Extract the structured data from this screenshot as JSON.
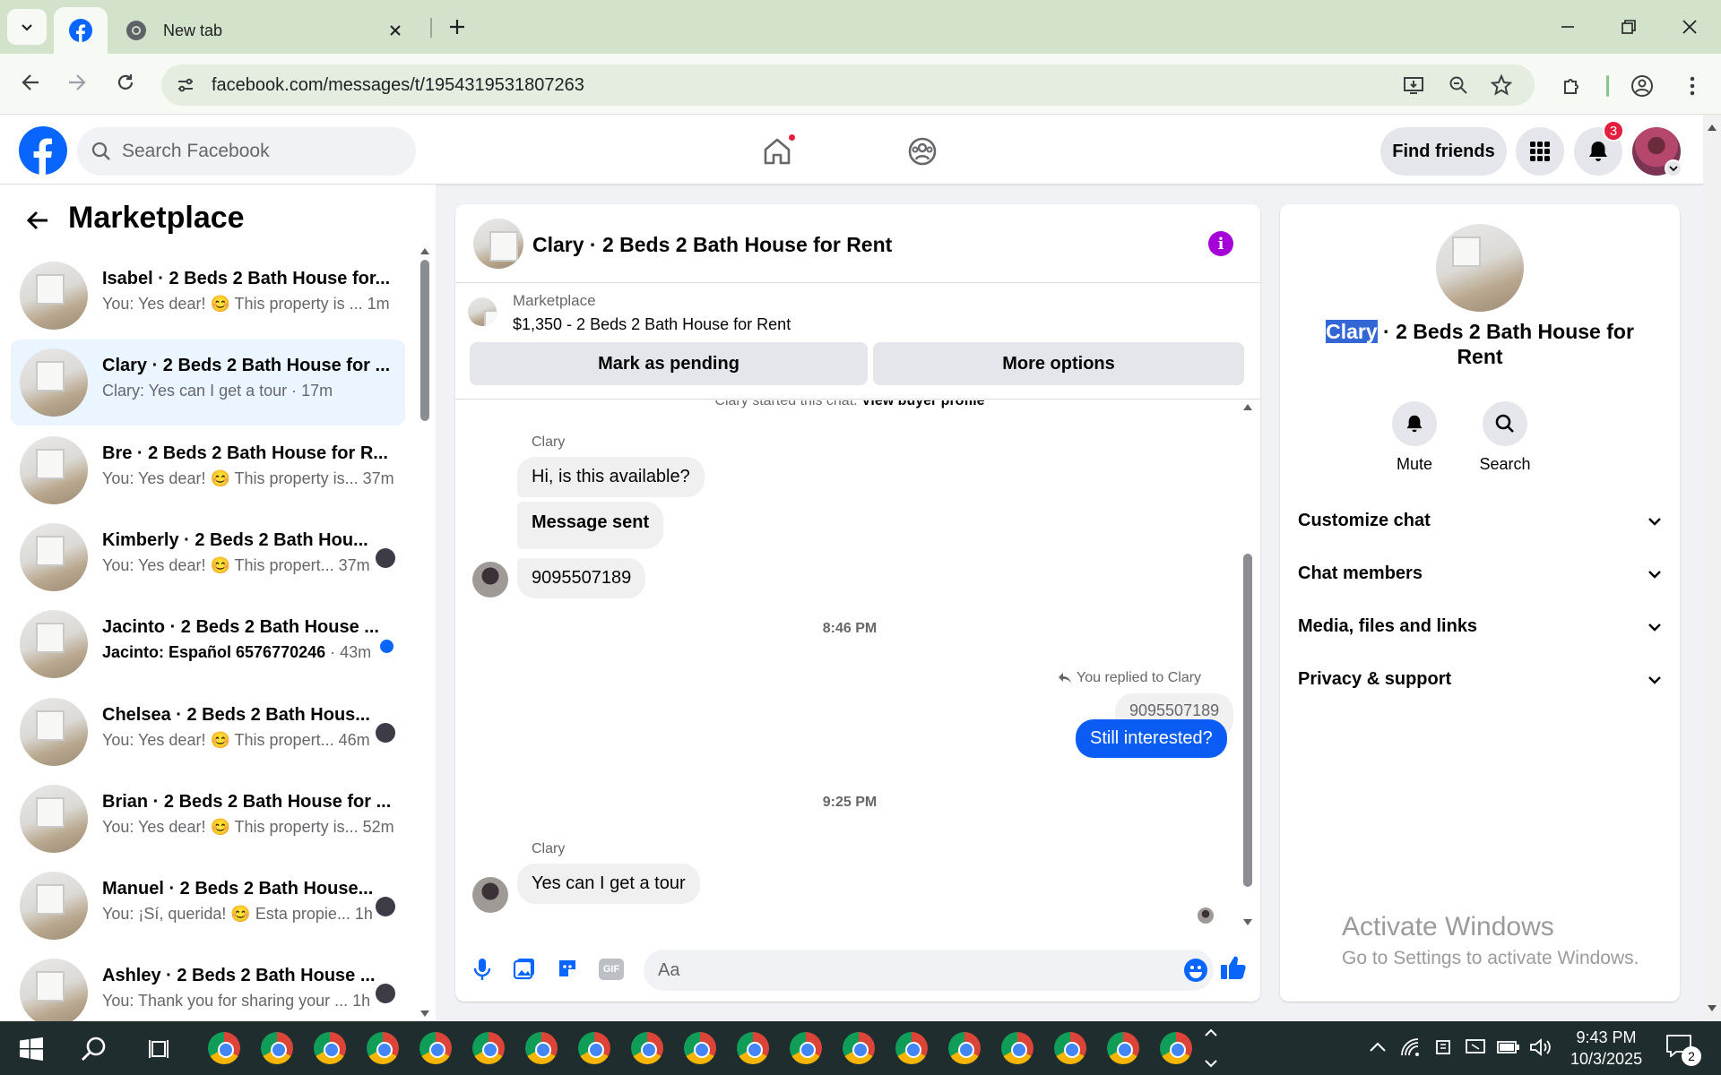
{
  "browser": {
    "tabs": [
      {
        "label": "New tab"
      }
    ],
    "url": "facebook.com/messages/t/1954319531807263"
  },
  "fb": {
    "search_placeholder": "Search Facebook",
    "find_friends": "Find friends",
    "notification_count": "3"
  },
  "sidebar": {
    "title": "Marketplace",
    "conversations": [
      {
        "title": "Isabel · 2 Beds 2 Bath House for...",
        "preview": "You: Yes dear! 😊 This property is ...",
        "time": "1m"
      },
      {
        "title": "Clary · 2 Beds 2 Bath House for ...",
        "preview": "Clary: Yes can I get a tour",
        "time": "· 17m"
      },
      {
        "title": "Bre · 2 Beds 2 Bath House for R...",
        "preview": "You: Yes dear! 😊 This property is...",
        "time": "37m"
      },
      {
        "title": "Kimberly · 2 Beds 2 Bath Hou...",
        "preview": "You: Yes dear! 😊 This propert...",
        "time": "37m"
      },
      {
        "title": "Jacinto · 2 Beds 2 Bath House ...",
        "preview": "Jacinto: Español 6576770246",
        "time": "· 43m"
      },
      {
        "title": "Chelsea · 2 Beds 2 Bath Hous...",
        "preview": "You: Yes dear! 😊 This propert...",
        "time": "46m"
      },
      {
        "title": "Brian · 2 Beds 2 Bath House for ...",
        "preview": "You: Yes dear! 😊 This property is...",
        "time": "52m"
      },
      {
        "title": "Manuel · 2 Beds 2 Bath House...",
        "preview": "You: ¡Sí, querida! 😊 Esta propie...",
        "time": "1h"
      },
      {
        "title": "Ashley · 2 Beds 2 Bath House ...",
        "preview": "You: Thank you for sharing your ...",
        "time": "1h"
      }
    ]
  },
  "chat": {
    "header_title": "Clary · 2 Beds 2 Bath House for Rent",
    "listing_source": "Marketplace",
    "listing_title": "$1,350 - 2 Beds 2 Bath House for Rent",
    "mark_pending": "Mark as pending",
    "more_options": "More options",
    "started_text": "Clary started this chat.",
    "view_profile": "View buyer profile",
    "sender1": "Clary",
    "msg1": "Hi, is this available?",
    "msg2": "Message sent",
    "msg3": "9095507189",
    "time1": "8:46 PM",
    "replied_label": "You replied to Clary",
    "quoted": "9095507189",
    "my_msg": "Still interested?",
    "time2": "9:25 PM",
    "sender2": "Clary",
    "msg4": "Yes can I get a tour",
    "input_placeholder": "Aa"
  },
  "details": {
    "title_name": "Clary",
    "title_rest": " · 2 Beds 2 Bath House for",
    "title_line2": "Rent",
    "mute": "Mute",
    "search": "Search",
    "sections": [
      "Customize chat",
      "Chat members",
      "Media, files and links",
      "Privacy & support"
    ]
  },
  "watermark": {
    "line1": "Activate Windows",
    "line2": "Go to Settings to activate Windows."
  },
  "taskbar": {
    "time": "9:43 PM",
    "date": "10/3/2025",
    "notif": "2"
  },
  "colors": {
    "fb_blue": "#0866ff",
    "selected_bg": "#ebf5ff",
    "my_bubble": "#0a5cf5",
    "chrome_bg": "#d3e3cb"
  }
}
